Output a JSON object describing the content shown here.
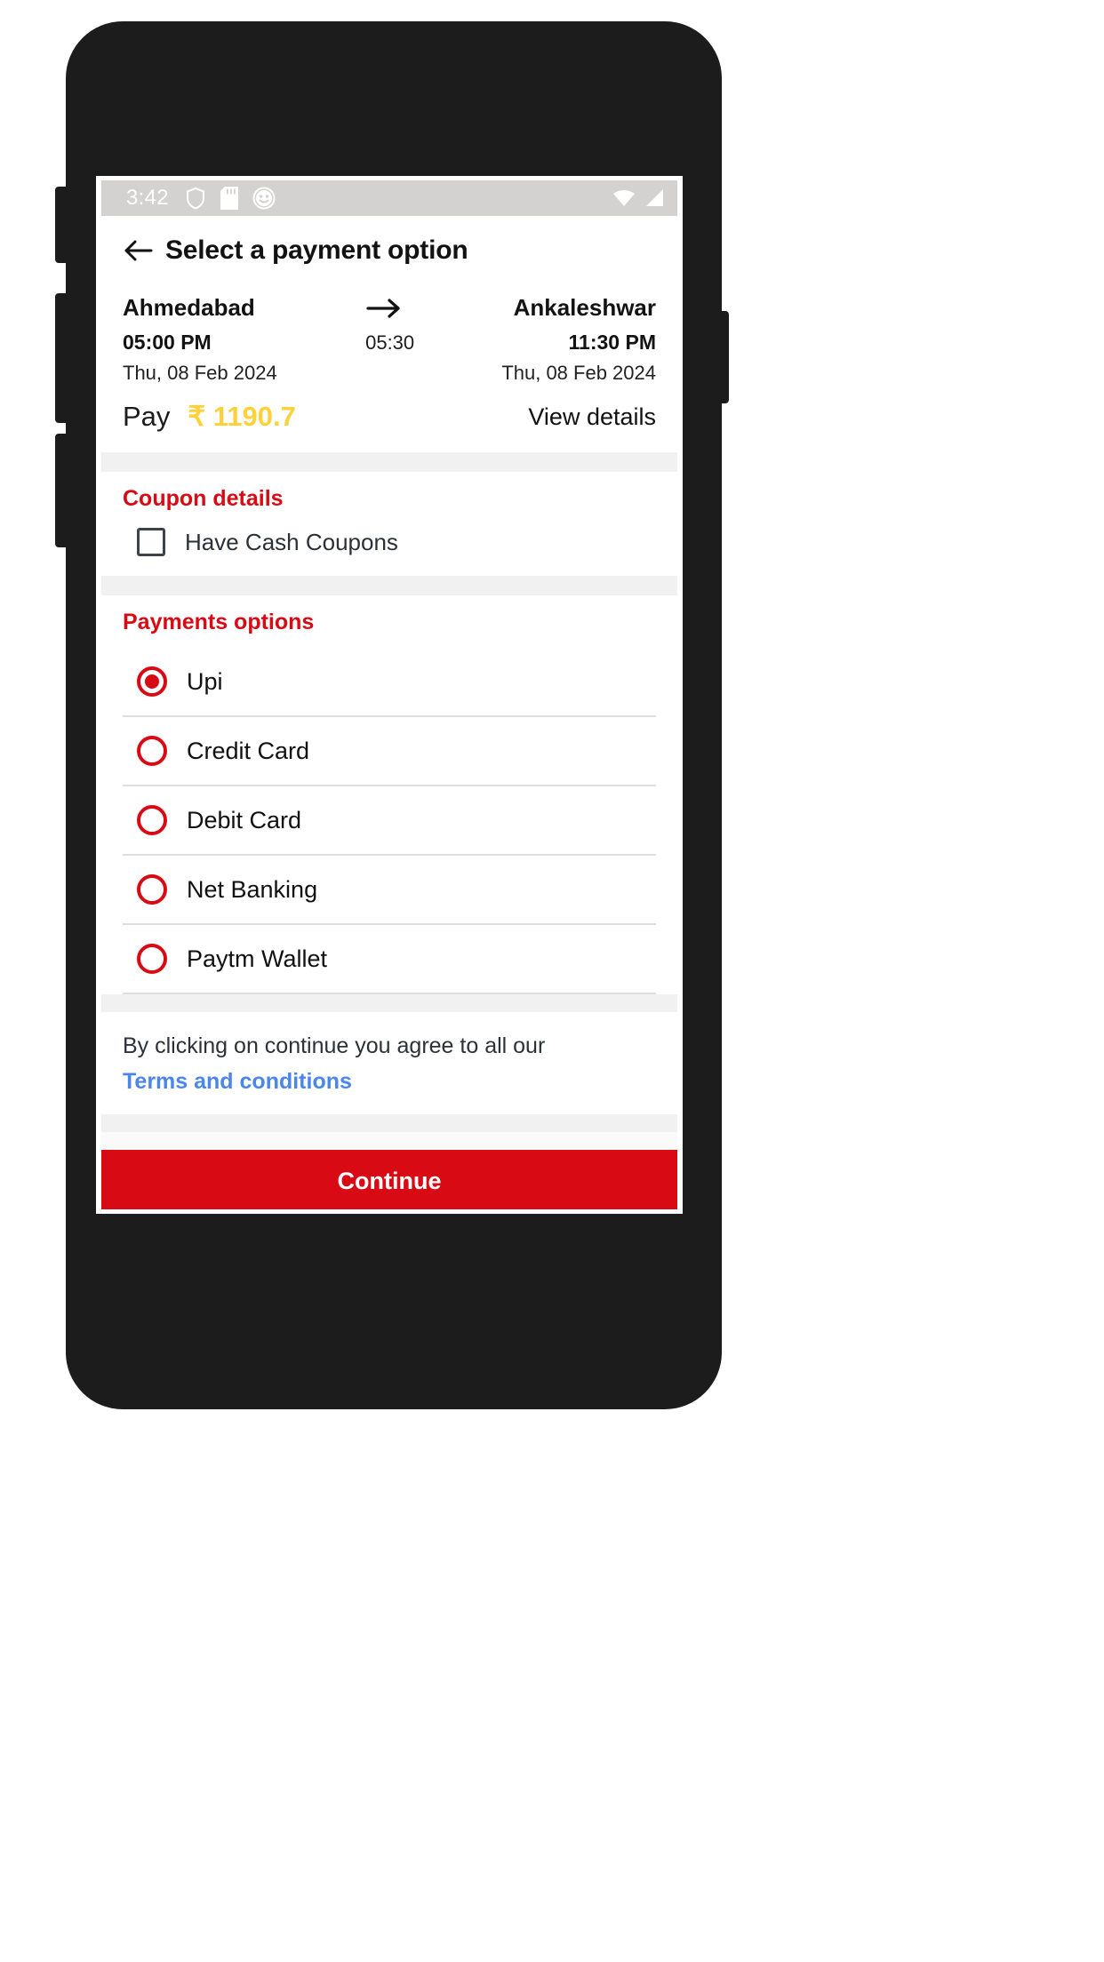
{
  "status_bar": {
    "time": "3:42",
    "left_icons": [
      "shield-icon",
      "sd-card-icon",
      "face-emoji-icon"
    ],
    "right_icons": [
      "wifi-icon",
      "cellular-signal-icon"
    ],
    "background_color": "#d4d2d0"
  },
  "header": {
    "back_icon": "back-arrow-icon",
    "title": "Select a payment option"
  },
  "journey": {
    "origin_city": "Ahmedabad",
    "destination_city": "Ankaleshwar",
    "arrow_icon": "right-arrow-icon",
    "departure_time": "05:00 PM",
    "duration": "05:30",
    "arrival_time": "11:30 PM",
    "departure_date": "Thu, 08 Feb 2024",
    "arrival_date": "Thu, 08 Feb 2024"
  },
  "pay": {
    "label": "Pay",
    "amount": "₹ 1190.7",
    "amount_color": "#FDD13A",
    "view_details": "View details"
  },
  "coupon": {
    "title": "Coupon details",
    "checkbox_label": "Have Cash Coupons",
    "checked": false
  },
  "payments": {
    "title": "Payments options",
    "options": [
      {
        "label": "Upi",
        "selected": true
      },
      {
        "label": "Credit Card",
        "selected": false
      },
      {
        "label": "Debit Card",
        "selected": false
      },
      {
        "label": "Net Banking",
        "selected": false
      },
      {
        "label": "Paytm Wallet",
        "selected": false
      }
    ]
  },
  "terms": {
    "text": "By clicking on continue you agree to all our",
    "link": "Terms and conditions",
    "link_color": "#4a87e8"
  },
  "footer": {
    "continue_label": "Continue",
    "continue_color": "#d80b14"
  },
  "theme": {
    "accent_red": "#d80b14",
    "divider": "#dedede",
    "section_gap": "#f1f1f1"
  }
}
